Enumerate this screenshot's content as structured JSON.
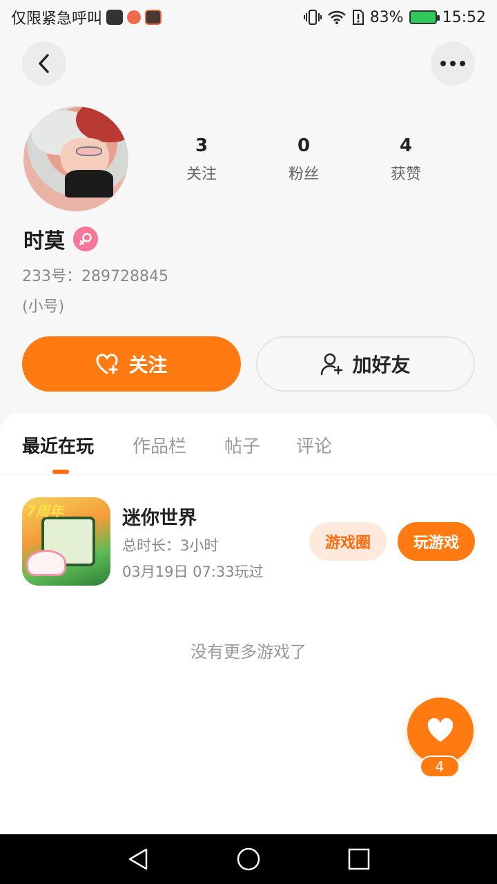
{
  "status_bar": {
    "carrier_text": "仅限紧急呼叫",
    "battery": "83%",
    "time": "15:52"
  },
  "profile": {
    "name": "时莫",
    "id_line": "233号：289728845",
    "sub_line": "(小号)",
    "stats": [
      {
        "value": "3",
        "label": "关注"
      },
      {
        "value": "0",
        "label": "粉丝"
      },
      {
        "value": "4",
        "label": "获赞"
      }
    ],
    "follow_label": "关注",
    "add_friend_label": "加好友"
  },
  "tabs": [
    "最近在玩",
    "作品栏",
    "帖子",
    "评论"
  ],
  "game": {
    "title": "迷你世界",
    "duration": "总时长：3小时",
    "last_played": "03月19日 07:33玩过",
    "icon_badge": "7周年",
    "circle_label": "游戏圈",
    "play_label": "玩游戏"
  },
  "empty_text": "没有更多游戏了",
  "fab_count": "4",
  "colors": {
    "accent": "#ff7a10",
    "accent_light": "#ffe9dc",
    "gender": "#f67799"
  }
}
